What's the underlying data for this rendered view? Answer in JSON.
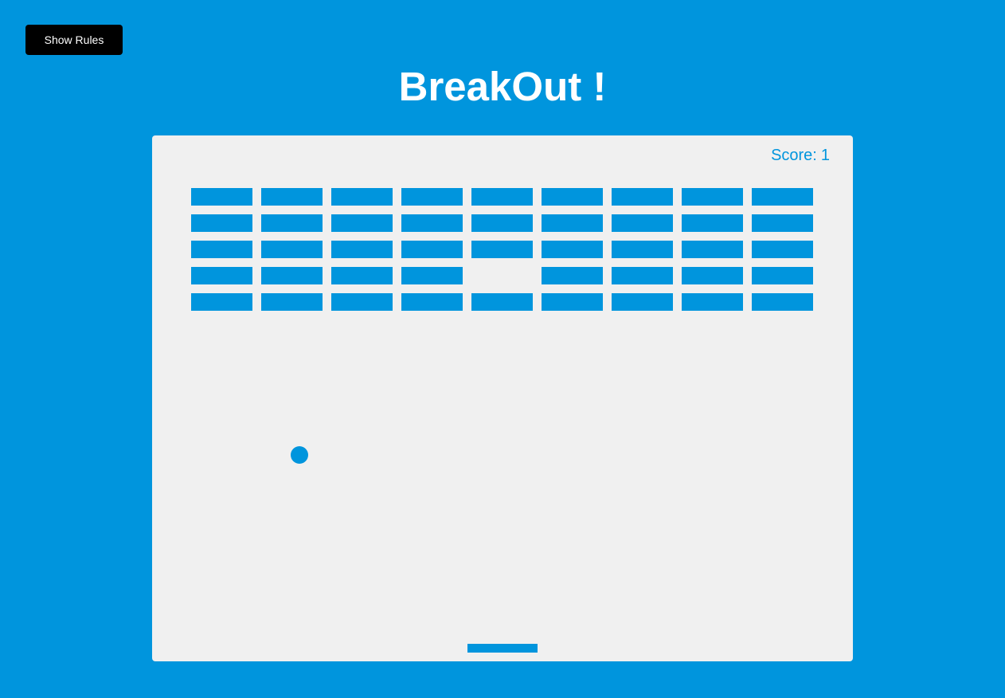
{
  "header": {
    "rules_button_label": "Show Rules",
    "title": "BreakOut !"
  },
  "game": {
    "score_label": "Score:",
    "score": "1",
    "bricks": {
      "columns": 9,
      "rows": 5,
      "destroyed": [
        [
          4,
          3
        ]
      ]
    }
  },
  "colors": {
    "background": "#0095dd",
    "board": "#f0f0f0",
    "accent": "#0095dd",
    "button": "#000000",
    "button_text": "#ffffff",
    "title_text": "#ffffff"
  }
}
